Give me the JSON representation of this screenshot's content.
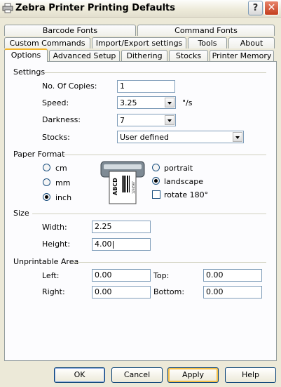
{
  "window": {
    "title": "Zebra Printer Printing Defaults"
  },
  "tabs_row1": [
    "Barcode Fonts",
    "Command Fonts"
  ],
  "tabs_row2": [
    "Custom Commands",
    "Import/Export settings",
    "Tools",
    "About"
  ],
  "tabs_row3": [
    "Options",
    "Advanced Setup",
    "Dithering",
    "Stocks",
    "Printer Memory"
  ],
  "settings": {
    "group": "Settings",
    "copies_label": "No. Of Copies:",
    "copies_value": "1",
    "speed_label": "Speed:",
    "speed_value": "3.25",
    "speed_unit": "\"/s",
    "darkness_label": "Darkness:",
    "darkness_value": "7",
    "stocks_label": "Stocks:",
    "stocks_value": "User defined"
  },
  "paper_format": {
    "group": "Paper Format",
    "units": [
      "cm",
      "mm",
      "inch"
    ],
    "selected_unit": "inch",
    "orientation": [
      "portrait",
      "landscape"
    ],
    "selected_orientation": "landscape",
    "rotate_label": "rotate 180°",
    "rotate_checked": false,
    "preview_text": "ABCD",
    "preview_number": "1234567"
  },
  "size": {
    "group": "Size",
    "width_label": "Width:",
    "width_value": "2.25",
    "height_label": "Height:",
    "height_value": "4.00"
  },
  "unprintable": {
    "group": "Unprintable Area",
    "left_label": "Left:",
    "left_value": "0.00",
    "top_label": "Top:",
    "top_value": "0.00",
    "right_label": "Right:",
    "right_value": "0.00",
    "bottom_label": "Bottom:",
    "bottom_value": "0.00"
  },
  "buttons": {
    "ok": "OK",
    "cancel": "Cancel",
    "apply": "Apply",
    "help": "Help"
  },
  "colors": {
    "xp_face": "#ece9d8",
    "tab_highlight": "#f4b62a",
    "close_red": "#c33d1d"
  }
}
